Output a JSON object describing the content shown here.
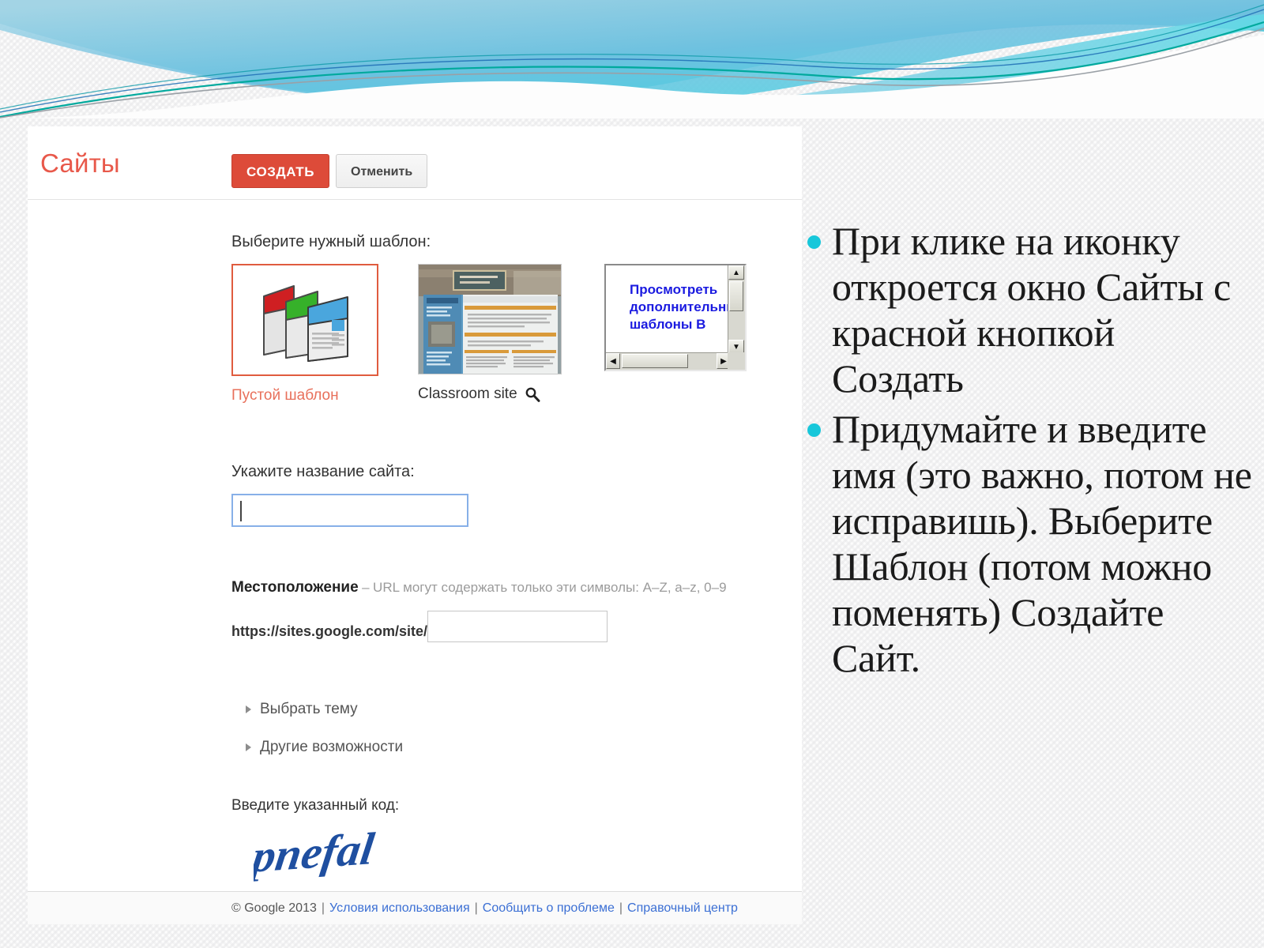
{
  "slide": {
    "theme_accent": "#17c7da",
    "background": "#fcfcfc"
  },
  "sites_window": {
    "logo": "Сайты",
    "create_button": "СОЗДАТЬ",
    "cancel_button": "Отменить",
    "template_section_label": "Выберите нужный шаблон:",
    "templates": [
      {
        "name": "Пустой шаблон",
        "selected": true,
        "kind": "blank-template-icon"
      },
      {
        "name": "Classroom site",
        "selected": false,
        "kind": "classroom-thumbnail"
      }
    ],
    "more_templates_box": {
      "link_text": "Просмотреть дополнительные шаблоны В",
      "link_color": "#1a1ae0"
    },
    "site_name": {
      "label": "Укажите название сайта:",
      "value": ""
    },
    "location": {
      "label": "Местоположение",
      "dash": "–",
      "hint": "URL могут содержать только эти символы: A–Z, a–z, 0–9",
      "url_prefix": "https://sites.google.com/site/",
      "value": ""
    },
    "disclosures": [
      "Выбрать тему",
      "Другие возможности"
    ],
    "captcha": {
      "label": "Введите указанный код:",
      "text": "pnefal"
    },
    "footer": {
      "copyright": "© Google 2013",
      "separator": "|",
      "links": [
        "Условия использования",
        "Сообщить о проблеме",
        "Справочный центр"
      ]
    }
  },
  "notes": {
    "items": [
      "При клике на иконку откроется окно Сайты с красной кнопкой Создать",
      " Придумайте и введите имя (это важно, потом не исправишь). Выберите Шаблон (потом можно поменять) Создайте Сайт."
    ]
  }
}
